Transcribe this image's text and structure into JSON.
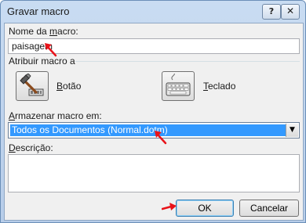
{
  "window": {
    "title": "Gravar macro",
    "help_button": "?",
    "close_button": "✕"
  },
  "macro_name": {
    "label_prefix": "Nome da ",
    "label_underlined": "m",
    "label_suffix": "acro:",
    "value": "paisagem"
  },
  "assign": {
    "label": "Atribuir macro a",
    "button_label_underlined": "B",
    "button_label_rest": "otão",
    "keyboard_label_underlined": "T",
    "keyboard_label_rest": "eclado"
  },
  "store": {
    "label_underlined": "A",
    "label_rest": "rmazenar macro em:",
    "selected_option": "Todos os Documentos (Normal.dotm)"
  },
  "description": {
    "label_underlined": "D",
    "label_rest": "escrição:",
    "value": ""
  },
  "buttons": {
    "ok": "OK",
    "cancel": "Cancelar"
  },
  "colors": {
    "selection": "#3399ff",
    "annotation_arrow": "#e8131a"
  }
}
